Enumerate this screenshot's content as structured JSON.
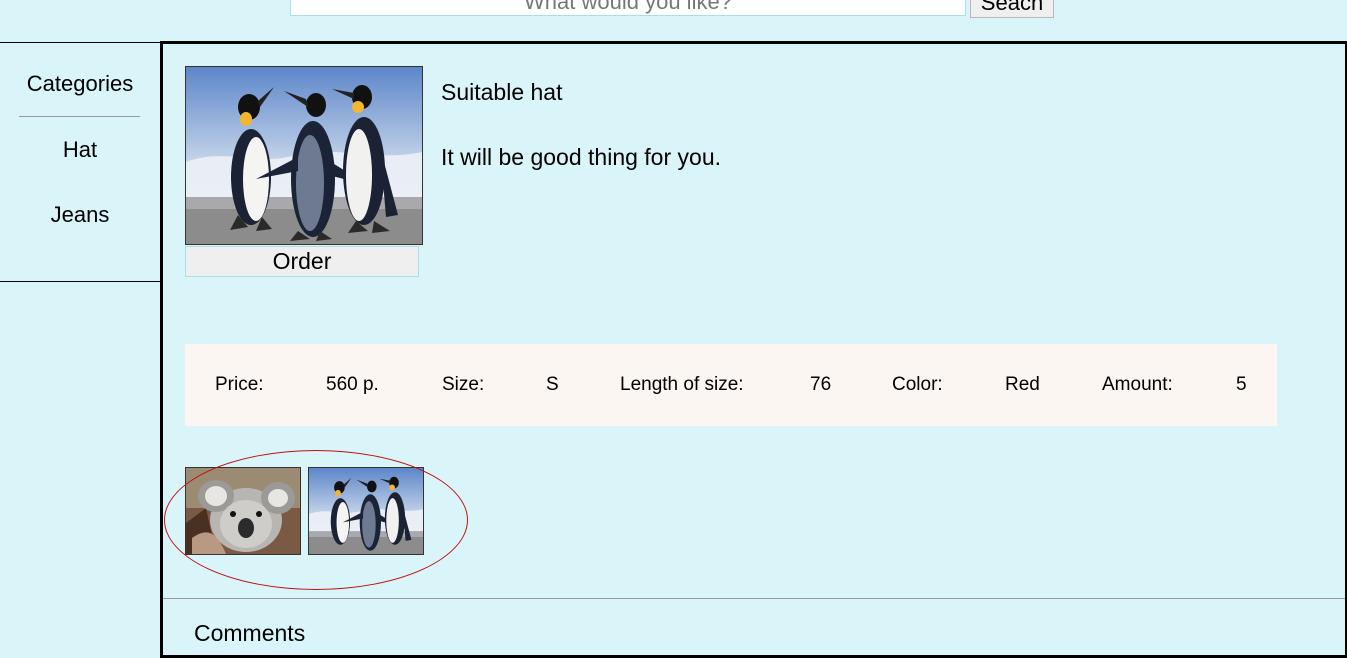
{
  "search": {
    "placeholder": "What would you like?",
    "button_label": "Seach"
  },
  "sidebar": {
    "title": "Categories",
    "items": [
      {
        "label": "Hat"
      },
      {
        "label": "Jeans"
      }
    ]
  },
  "product": {
    "name": "Suitable hat",
    "description": "It will be good thing for you.",
    "image": "penguins-photo",
    "order_label": "Order",
    "specs": {
      "price_label": "Price:",
      "price_value": "560 p.",
      "size_label": "Size:",
      "size_value": "S",
      "length_label": "Length of size:",
      "length_value": "76",
      "color_label": "Color:",
      "color_value": "Red",
      "amount_label": "Amount:",
      "amount_value": "5"
    },
    "thumbnails": [
      {
        "image": "koala-photo"
      },
      {
        "image": "penguins-photo"
      }
    ]
  },
  "comments": {
    "title": "Comments"
  },
  "colors": {
    "background": "#d9f5f9",
    "specs_background": "#fbf6f1",
    "highlight": "#c01010"
  }
}
